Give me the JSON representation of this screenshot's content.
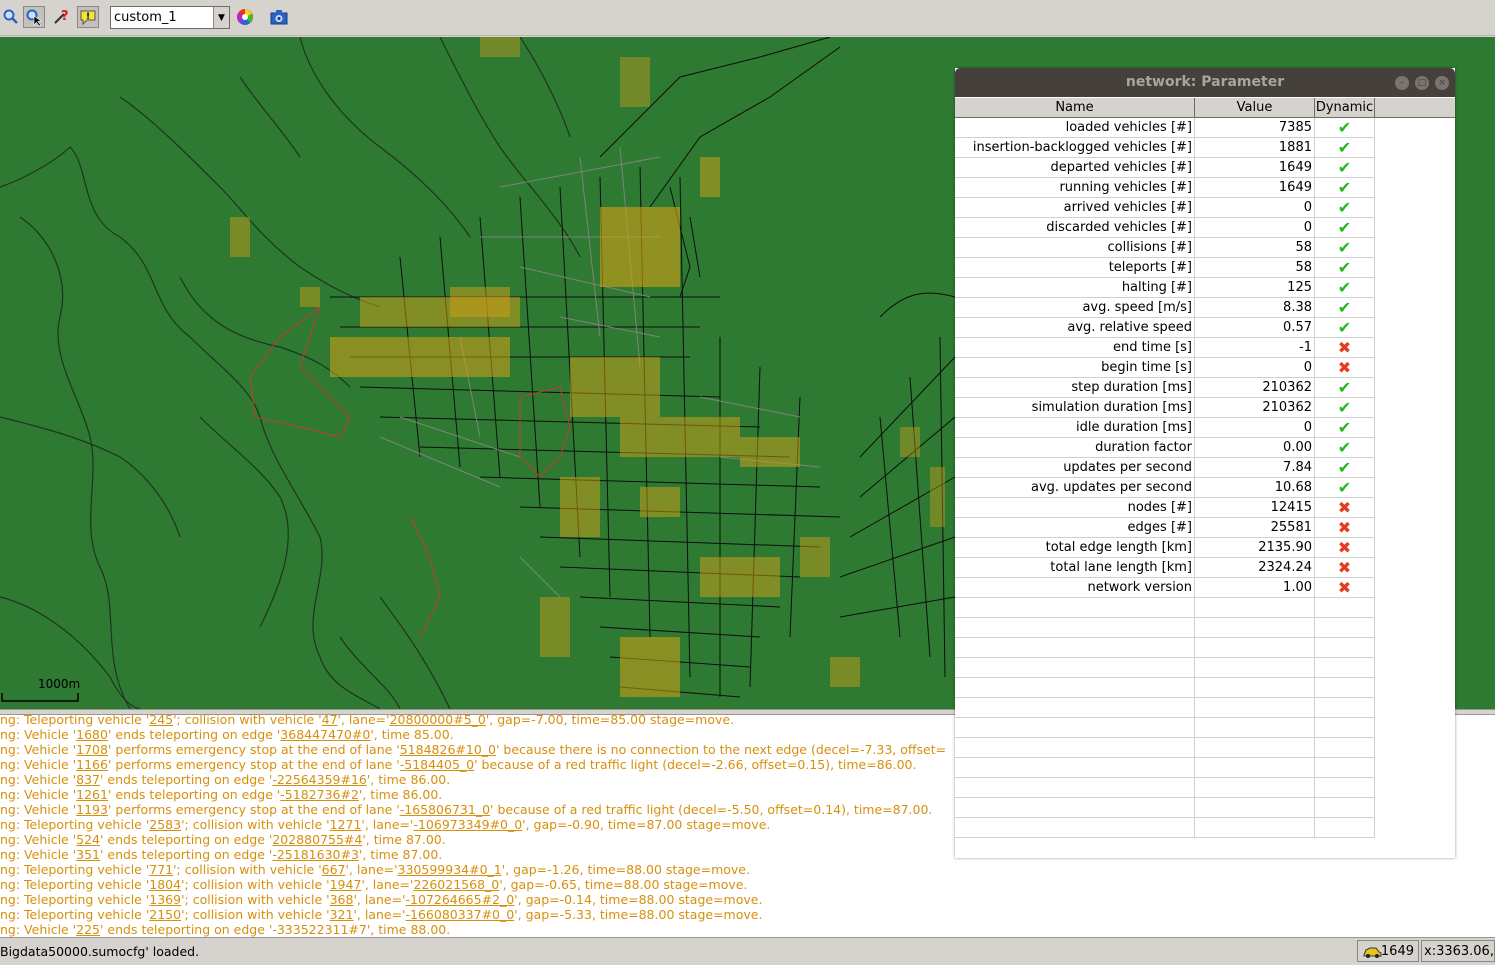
{
  "toolbar": {
    "buttons": [
      {
        "name": "locate-icon"
      },
      {
        "name": "select-icon"
      },
      {
        "name": "help-icon"
      },
      {
        "name": "tooltip-icon"
      }
    ],
    "scheme_select": "custom_1",
    "color_wheel_icon": "color-wheel-icon",
    "screenshot_icon": "camera-icon"
  },
  "map": {
    "scale_label": "1000m",
    "background_color": "#2f7a32",
    "vehicle_color": "#d4a018"
  },
  "dialog": {
    "title": "network: Parameter",
    "columns": [
      "Name",
      "Value",
      "Dynamic"
    ],
    "rows": [
      {
        "name": "loaded vehicles [#]",
        "value": "7385",
        "dynamic": true
      },
      {
        "name": "insertion-backlogged vehicles [#]",
        "value": "1881",
        "dynamic": true
      },
      {
        "name": "departed vehicles [#]",
        "value": "1649",
        "dynamic": true
      },
      {
        "name": "running vehicles [#]",
        "value": "1649",
        "dynamic": true
      },
      {
        "name": "arrived vehicles [#]",
        "value": "0",
        "dynamic": true
      },
      {
        "name": "discarded vehicles [#]",
        "value": "0",
        "dynamic": true
      },
      {
        "name": "collisions [#]",
        "value": "58",
        "dynamic": true
      },
      {
        "name": "teleports [#]",
        "value": "58",
        "dynamic": true
      },
      {
        "name": "halting [#]",
        "value": "125",
        "dynamic": true
      },
      {
        "name": "avg. speed [m/s]",
        "value": "8.38",
        "dynamic": true
      },
      {
        "name": "avg. relative speed",
        "value": "0.57",
        "dynamic": true
      },
      {
        "name": "end time [s]",
        "value": "-1",
        "dynamic": false
      },
      {
        "name": "begin time [s]",
        "value": "0",
        "dynamic": false
      },
      {
        "name": "step duration [ms]",
        "value": "210362",
        "dynamic": true
      },
      {
        "name": "simulation duration [ms]",
        "value": "210362",
        "dynamic": true
      },
      {
        "name": "idle duration [ms]",
        "value": "0",
        "dynamic": true
      },
      {
        "name": "duration factor",
        "value": "0.00",
        "dynamic": true
      },
      {
        "name": "updates per second",
        "value": "7.84",
        "dynamic": true
      },
      {
        "name": "avg. updates per second",
        "value": "10.68",
        "dynamic": true
      },
      {
        "name": "nodes [#]",
        "value": "12415",
        "dynamic": false
      },
      {
        "name": "edges [#]",
        "value": "25581",
        "dynamic": false
      },
      {
        "name": "total edge length [km]",
        "value": "2135.90",
        "dynamic": false
      },
      {
        "name": "total lane length [km]",
        "value": "2324.24",
        "dynamic": false
      },
      {
        "name": "network version",
        "value": "1.00",
        "dynamic": false
      }
    ],
    "check_color": "#1fb81f",
    "cross_color": "#e63b22"
  },
  "log": {
    "text_color": "#d7900e",
    "lines": [
      {
        "parts": [
          "ng: Teleporting vehicle '",
          {
            "u": "245"
          },
          "'; collision with vehicle '",
          {
            "u": "47"
          },
          "', lane='",
          {
            "u": "20800000#5_0"
          },
          "', gap=-7.00, time=85.00 stage=move."
        ]
      },
      {
        "parts": [
          "ng: Vehicle '",
          {
            "u": "1680"
          },
          "' ends teleporting on edge '",
          {
            "u": "368447470#0"
          },
          "', time 85.00."
        ]
      },
      {
        "parts": [
          "ng: Vehicle '",
          {
            "u": "1708"
          },
          "' performs emergency stop at the end of lane '",
          {
            "u": "5184826#10_0"
          },
          "' because there is no connection to the next edge (decel=-7.33, offset="
        ]
      },
      {
        "parts": [
          "ng: Vehicle '",
          {
            "u": "1166"
          },
          "' performs emergency stop at the end of lane '",
          {
            "u": "-5184405_0"
          },
          "' because of a red traffic light (decel=-2.66, offset=0.15), time=86.00."
        ]
      },
      {
        "parts": [
          "ng: Vehicle '",
          {
            "u": "837"
          },
          "' ends teleporting on edge '",
          {
            "u": "-22564359#16"
          },
          "', time 86.00."
        ]
      },
      {
        "parts": [
          "ng: Vehicle '",
          {
            "u": "1261"
          },
          "' ends teleporting on edge '",
          {
            "u": "-5182736#2"
          },
          "', time 86.00."
        ]
      },
      {
        "parts": [
          "ng: Vehicle '",
          {
            "u": "1193"
          },
          "' performs emergency stop at the end of lane '",
          {
            "u": "-165806731_0"
          },
          "' because of a red traffic light (decel=-5.50, offset=0.14), time=87.00."
        ]
      },
      {
        "parts": [
          "ng: Teleporting vehicle '",
          {
            "u": "2583"
          },
          "'; collision with vehicle '",
          {
            "u": "1271"
          },
          "', lane='",
          {
            "u": "-106973349#0_0"
          },
          "', gap=-0.90, time=87.00 stage=move."
        ]
      },
      {
        "parts": [
          "ng: Vehicle '",
          {
            "u": "524"
          },
          "' ends teleporting on edge '",
          {
            "u": "202880755#4"
          },
          "', time 87.00."
        ]
      },
      {
        "parts": [
          "ng: Vehicle '",
          {
            "u": "351"
          },
          "' ends teleporting on edge '",
          {
            "u": "-25181630#3"
          },
          "', time 87.00."
        ]
      },
      {
        "parts": [
          "ng: Teleporting vehicle '",
          {
            "u": "771"
          },
          "'; collision with vehicle '",
          {
            "u": "667"
          },
          "', lane='",
          {
            "u": "330599934#0_1"
          },
          "', gap=-1.26, time=88.00 stage=move."
        ]
      },
      {
        "parts": [
          "ng: Teleporting vehicle '",
          {
            "u": "1804"
          },
          "'; collision with vehicle '",
          {
            "u": "1947"
          },
          "', lane='",
          {
            "u": "226021568_0"
          },
          "', gap=-0.65, time=88.00 stage=move."
        ]
      },
      {
        "parts": [
          "ng: Teleporting vehicle '",
          {
            "u": "1369"
          },
          "'; collision with vehicle '",
          {
            "u": "368"
          },
          "', lane='",
          {
            "u": "-107264665#2_0"
          },
          "', gap=-0.14, time=88.00 stage=move."
        ]
      },
      {
        "parts": [
          "ng: Teleporting vehicle '",
          {
            "u": "2150"
          },
          "'; collision with vehicle '",
          {
            "u": "321"
          },
          "', lane='",
          {
            "u": "-166080337#0_0"
          },
          "', gap=-5.33, time=88.00 stage=move."
        ]
      },
      {
        "parts": [
          "ng: Vehicle '",
          {
            "u": "225"
          },
          "' ends teleporting on edge '-333522311#7', time 88.00."
        ]
      }
    ]
  },
  "status": {
    "message": "Bigdata50000.sumocfg' loaded.",
    "vehicle_count": "1649",
    "coordinates": "x:3363.06,"
  }
}
